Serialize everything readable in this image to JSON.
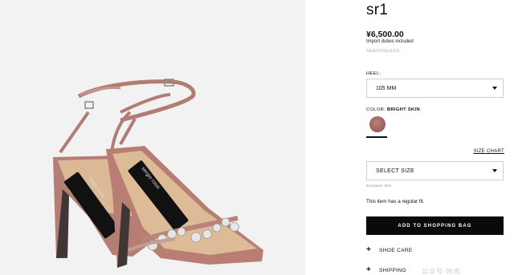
{
  "product": {
    "title": "sr1",
    "price": "¥6,500.00",
    "duties_note": "Import duties included",
    "season_tag": "SEASONLESS",
    "image_brand_text": "sergio rossi"
  },
  "heel": {
    "label": "HEEL:",
    "selected": "105 MM"
  },
  "color": {
    "label_prefix": "COLOR:",
    "selected_name": "BRIGHT SKIN",
    "swatch_color": "#a36a62"
  },
  "size": {
    "chart_link": "SIZE CHART",
    "placeholder": "SELECT SIZE",
    "european_note": "European Size",
    "fit_note": "This item has a regular fit."
  },
  "actions": {
    "add_to_bag": "ADD TO SHOPPING BAG"
  },
  "accordions": {
    "shoe_care": "SHOE CARE",
    "shipping": "SHIPPING"
  },
  "watermark": "公众号·时尚"
}
